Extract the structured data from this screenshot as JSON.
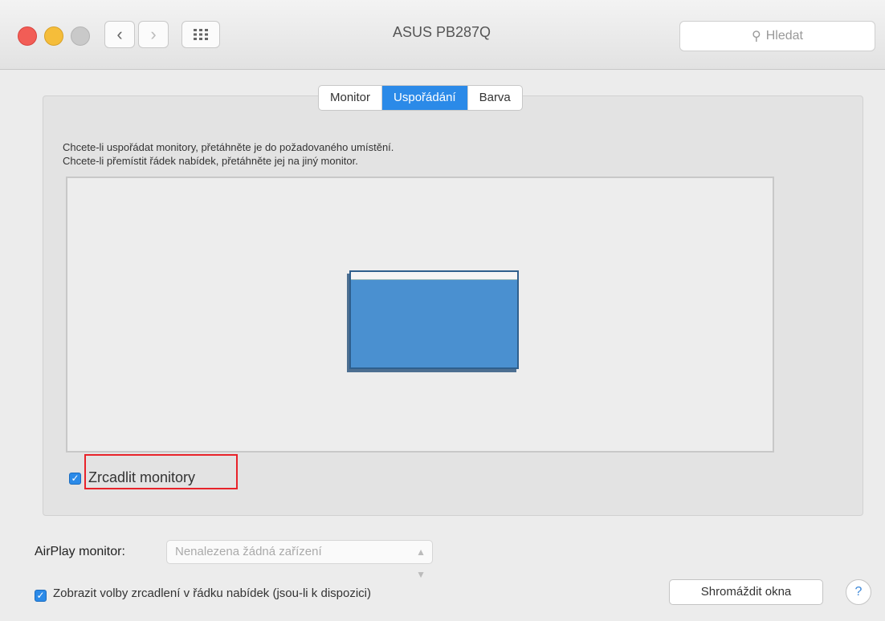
{
  "window": {
    "title": "ASUS PB287Q",
    "search_placeholder": "Hledat",
    "icons": {
      "back": "chevron-left-icon",
      "forward": "chevron-right-icon",
      "grid": "grid-icon",
      "search": "search-icon"
    }
  },
  "tabs": [
    {
      "label": "Monitor",
      "active": false
    },
    {
      "label": "Uspořádání",
      "active": true
    },
    {
      "label": "Barva",
      "active": false
    }
  ],
  "arrangement": {
    "instruction_1": "Chcete-li uspořádat monitory, přetáhněte je do požadovaného umístění.",
    "instruction_2": "Chcete-li přemístit řádek nabídek, přetáhněte jej na jiný monitor."
  },
  "mirror": {
    "label": "Zrcadlit monitory",
    "checked": true
  },
  "airplay": {
    "label": "AirPlay monitor:",
    "value": "Nenalezena žádná zařízení"
  },
  "show_mirroring": {
    "label": "Zobrazit volby zrcadlení v řádku nabídek (jsou-li k dispozici)",
    "checked": true
  },
  "buttons": {
    "gather": "Shromáždit okna",
    "help": "?"
  },
  "colors": {
    "accent": "#2b8ae8",
    "highlight": "#e8232a",
    "monitor": "#4a90d0"
  }
}
